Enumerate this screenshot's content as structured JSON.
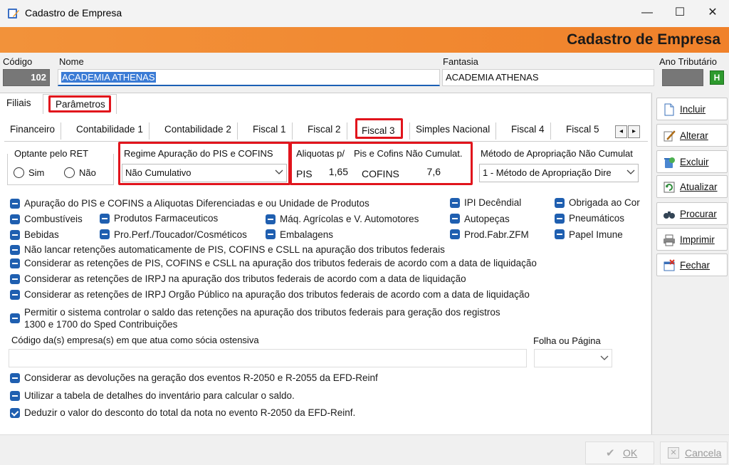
{
  "window": {
    "title": "Cadastro de Empresa",
    "minimize": "—",
    "maximize": "☐",
    "close": "✕"
  },
  "banner": {
    "title": "Cadastro de Empresa"
  },
  "header": {
    "codigo_label": "Código",
    "codigo_value": "102",
    "nome_label": "Nome",
    "nome_value": "ACADEMIA ATHENAS",
    "fantasia_label": "Fantasia",
    "fantasia_value": "ACADEMIA ATHENAS",
    "ano_label": "Ano Tributário",
    "ano_value": "",
    "ano_button": "H"
  },
  "main_tabs": [
    {
      "label": "Filiais"
    },
    {
      "label": "Parâmetros"
    }
  ],
  "sub_tabs": [
    {
      "label": "Financeiro"
    },
    {
      "label": "Contabilidade 1"
    },
    {
      "label": "Contabilidade 2"
    },
    {
      "label": "Fiscal 1"
    },
    {
      "label": "Fiscal 2"
    },
    {
      "label": "Fiscal 3"
    },
    {
      "label": "Simples Nacional"
    },
    {
      "label": "Fiscal 4"
    },
    {
      "label": "Fiscal 5"
    }
  ],
  "scroll": {
    "left": "◂",
    "right": "▸"
  },
  "ret": {
    "label": "Optante pelo RET",
    "sim": "Sim",
    "nao": "Não"
  },
  "regime": {
    "label": "Regime Apuração do PIS e COFINS",
    "value": "Não Cumulativo"
  },
  "aliquotas": {
    "label1": "Aliquotas p/",
    "label2": "Pis e Cofins Não Cumulat.",
    "pis_label": "PIS",
    "pis_value": "1,65",
    "cofins_label": "COFINS",
    "cofins_value": "7,6"
  },
  "metodo": {
    "label": "Método de Apropriação Não Cumulat",
    "value": "1 - Método de Apropriação Dire"
  },
  "checks": {
    "apuracao": "Apuração do PIS e COFINS a Aliquotas Diferenciadas e ou Unidade de Produtos",
    "combustiveis": "Combustíveis",
    "farmaceuticos": "Produtos Farmaceuticos",
    "maq": "Máq. Agrícolas e V. Automotores",
    "bebidas": "Bebidas",
    "perfumaria": "Pro.Perf./Toucador/Cosméticos",
    "embalagens": "Embalagens",
    "ipi": "IPI Decêndial",
    "autopecas": "Autopeças",
    "zfm": "Prod.Fabr.ZFM",
    "obrigada": "Obrigada ao Cor",
    "pneumaticos": "Pneumáticos",
    "papel": "Papel Imune",
    "nao_lancar": "Não lancar retenções automaticamente de PIS, COFINS e CSLL na apuração dos tributos federais",
    "considerar_pis": "Considerar as retenções de PIS, COFINS e CSLL na apuração dos tributos federais de acordo com a data de liquidação",
    "considerar_irpj": "Considerar as retenções de IRPJ na apuração dos tributos federais de acordo com a data de liquidação",
    "considerar_irpj_pub": "Considerar as retenções de IRPJ Orgão Público na apuração dos tributos federais de acordo com a data de liquidação",
    "permitir_1": "Permitir o sistema controlar o saldo das retenções na apuração dos tributos federais para geração dos registros",
    "permitir_2": "1300 e 1700 do Sped Contribuições",
    "devolucoes": "Considerar as devoluções na geração dos eventos R-2050 e R-2055 da EFD-Reinf",
    "inventario": "Utilizar a tabela de detalhes do inventário para calcular o saldo.",
    "deduzir": "Deduzir o valor do desconto do total da nota no evento R-2050 da EFD-Reinf."
  },
  "socia": {
    "label": "Código da(s) empresa(s) em que atua como sócia ostensiva",
    "value": ""
  },
  "folha": {
    "label": "Folha ou Página",
    "value": ""
  },
  "sidebar": {
    "incluir": "Incluir",
    "alterar": "Alterar",
    "excluir": "Excluir",
    "atualizar": "Atualizar",
    "procurar": "Procurar",
    "imprimir": "Imprimir",
    "fechar": "Fechar"
  },
  "footer": {
    "ok": "OK",
    "cancela": "Cancela"
  }
}
